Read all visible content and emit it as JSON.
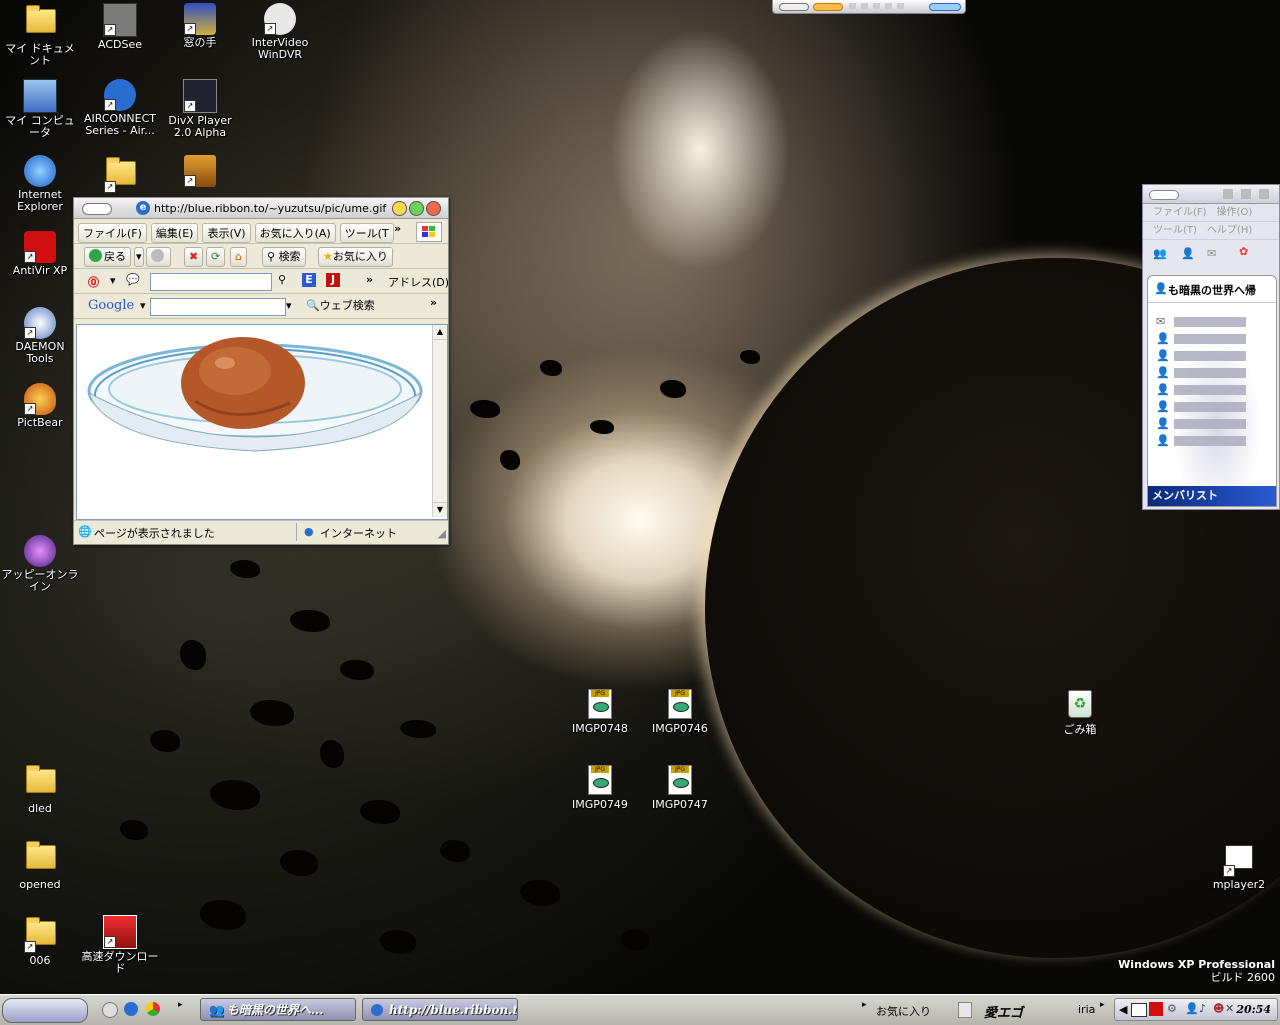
{
  "desktop_icons": [
    {
      "label": "マイ ドキュメント",
      "icon": "my-documents-icon"
    },
    {
      "label": "ACDSee",
      "icon": "acdsee-icon"
    },
    {
      "label": "窓の手",
      "icon": "madonote-icon"
    },
    {
      "label": "InterVideo WinDVR",
      "icon": "windvr-icon"
    },
    {
      "label": "マイ コンピュータ",
      "icon": "my-computer-icon"
    },
    {
      "label": "AIRCONNECT Series - Air...",
      "icon": "airconnect-icon"
    },
    {
      "label": "DivX Player 2.0 Alpha",
      "icon": "divx-icon"
    },
    {
      "label": "Internet Explorer",
      "icon": "internet-explorer-icon"
    },
    {
      "label": "AntiVir XP",
      "icon": "antivir-icon"
    },
    {
      "label": "DAEMON Tools",
      "icon": "daemon-tools-icon"
    },
    {
      "label": "PictBear",
      "icon": "pictbear-icon"
    },
    {
      "label": "アッピーオンライン",
      "icon": "appy-online-icon"
    },
    {
      "label": "dled",
      "icon": "folder-icon"
    },
    {
      "label": "opened",
      "icon": "folder-icon"
    },
    {
      "label": "006",
      "icon": "folder-icon"
    },
    {
      "label": "高速ダウンロード",
      "icon": "fast-download-icon"
    },
    {
      "label": "IMGP0748",
      "icon": "jpg-file-icon"
    },
    {
      "label": "IMGP0746",
      "icon": "jpg-file-icon"
    },
    {
      "label": "IMGP0749",
      "icon": "jpg-file-icon"
    },
    {
      "label": "IMGP0747",
      "icon": "jpg-file-icon"
    },
    {
      "label": "ごみ箱",
      "icon": "recycle-bin-icon"
    },
    {
      "label": "mplayer2",
      "icon": "mplayer-icon"
    }
  ],
  "browser": {
    "title": "http://blue.ribbon.to/~yuzutsu/pic/ume.gif - IE",
    "menu": [
      "ファイル(F)",
      "編集(E)",
      "表示(V)",
      "お気に入り(A)",
      "ツール(T"
    ],
    "more": "»",
    "back_label": "戻る",
    "search_label": "検索",
    "favorites_label": "お気に入り",
    "address_label": "アドレス(D)",
    "google_label": "Google",
    "web_search_label": "ウェブ検索",
    "status_text": "ページが表示されました",
    "zone_text": "インターネット"
  },
  "messenger": {
    "menu": [
      "ファイル(F)",
      "操作(O)",
      "ツール(T)",
      "ヘルプ(H)"
    ],
    "user_name": "も暗黒の世界へ帰",
    "footer": "メンバリスト",
    "contacts": 8
  },
  "watermark": {
    "line1": "Windows XP Professional",
    "line2": "ビルド 2600"
  },
  "taskbar": {
    "tasks": [
      {
        "label": "も暗黒の世界へ...",
        "icon": "messenger-icon"
      },
      {
        "label": "http://blue.ribbon.t...",
        "icon": "internet-explorer-icon"
      }
    ],
    "favorites_label": "お気に入り",
    "app_label": "愛エゴ",
    "iria_label": "iria",
    "clock": "20:54"
  }
}
